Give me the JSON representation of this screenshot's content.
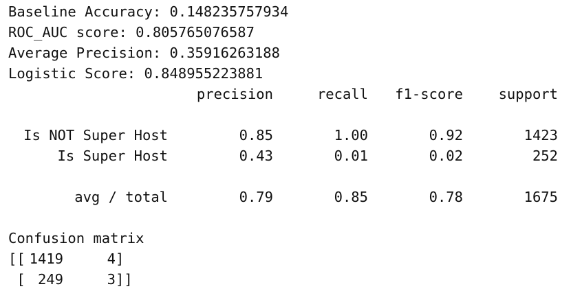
{
  "metrics": [
    {
      "label": "Baseline Accuracy:",
      "value": "0.148235757934"
    },
    {
      "label": "ROC_AUC score:",
      "value": "0.805765076587"
    },
    {
      "label": "Average Precision:",
      "value": "0.35916263188"
    },
    {
      "label": "Logistic Score:",
      "value": "0.848955223881"
    }
  ],
  "report": {
    "headers": [
      "precision",
      "recall",
      "f1-score",
      "support"
    ],
    "rows": [
      {
        "label": "Is NOT Super Host",
        "precision": "0.85",
        "recall": "1.00",
        "f1": "0.92",
        "support": "1423"
      },
      {
        "label": "Is Super Host",
        "precision": "0.43",
        "recall": "0.01",
        "f1": "0.02",
        "support": "252"
      }
    ],
    "total": {
      "label": "avg / total",
      "precision": "0.79",
      "recall": "0.85",
      "f1": "0.78",
      "support": "1675"
    }
  },
  "confusion": {
    "title": "Confusion matrix",
    "rows": [
      {
        "open": "[[",
        "a": "1419",
        "b": "4",
        "close": "]"
      },
      {
        "open": " [",
        "a": "249",
        "b": "3",
        "close": "]]"
      }
    ]
  }
}
